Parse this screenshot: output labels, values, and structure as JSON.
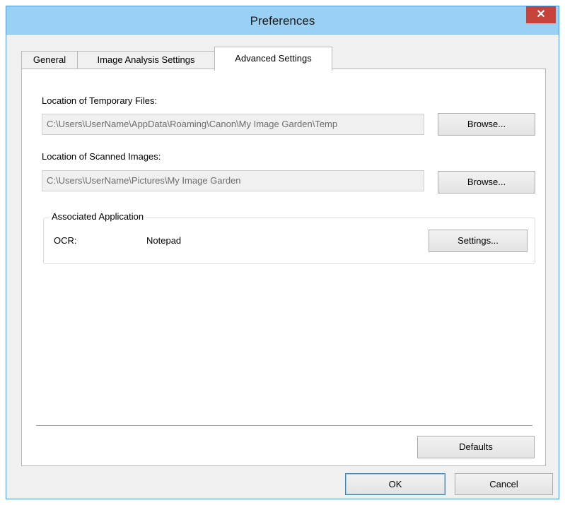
{
  "window": {
    "title": "Preferences",
    "close_symbol": "✕"
  },
  "tabs": [
    {
      "label": "General",
      "active": false
    },
    {
      "label": "Image Analysis Settings",
      "active": false
    },
    {
      "label": "Advanced Settings",
      "active": true
    }
  ],
  "temp_files": {
    "label": "Location of Temporary Files:",
    "value": "C:\\Users\\UserName\\AppData\\Roaming\\Canon\\My Image Garden\\Temp",
    "browse_label": "Browse..."
  },
  "scanned_images": {
    "label": "Location of Scanned Images:",
    "value": "C:\\Users\\UserName\\Pictures\\My Image Garden",
    "browse_label": "Browse..."
  },
  "associated_app": {
    "group_label": "Associated Application",
    "ocr_label": "OCR:",
    "ocr_value": "Notepad",
    "settings_label": "Settings..."
  },
  "defaults_label": "Defaults",
  "footer": {
    "ok_label": "OK",
    "cancel_label": "Cancel"
  },
  "colors": {
    "titlebar": "#9bd0f5",
    "close_button": "#c7423a",
    "window_border": "#4d9ad6"
  }
}
